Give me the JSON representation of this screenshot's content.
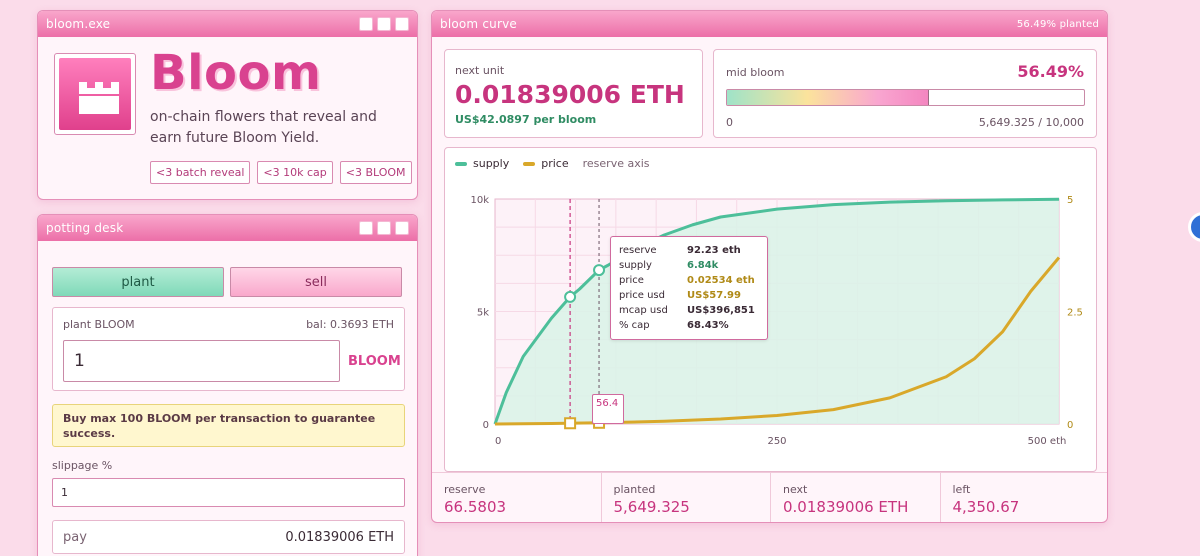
{
  "bloom_window": {
    "title": "bloom.exe",
    "brand": "Bloom",
    "tagline": "on-chain flowers that reveal and earn future Bloom Yield.",
    "chips": [
      "<3 batch reveal",
      "<3 10k cap",
      "<3 BLOOM"
    ]
  },
  "desk_window": {
    "title": "potting desk",
    "tabs": {
      "plant": "plant",
      "sell": "sell"
    },
    "field_label": "plant BLOOM",
    "balance": "bal: 0.3693 ETH",
    "amount": "1",
    "unit": "BLOOM",
    "warning": "Buy max 100 BLOOM per transaction to guarantee success.",
    "slippage_label": "slippage %",
    "slippage_value": "1",
    "pay_label": "pay",
    "pay_value": "0.01839006 ETH"
  },
  "curve_window": {
    "title": "bloom curve",
    "planted_badge": "56.49% planted",
    "next_unit": {
      "label": "next unit",
      "value": "0.01839006 ETH",
      "usd": "US$42.0897 per bloom"
    },
    "mid_bloom": {
      "label": "mid bloom",
      "pct": "56.49%",
      "fraction": 0.5649,
      "min": "0",
      "count": "5,649.325 / 10,000"
    },
    "legend": {
      "supply": "supply",
      "price": "price",
      "axis": "reserve axis"
    },
    "tooltip": {
      "rows": [
        {
          "k": "reserve",
          "v": "92.23 eth"
        },
        {
          "k": "supply",
          "v": "6.84k"
        },
        {
          "k": "price",
          "v": "0.02534 eth"
        },
        {
          "k": "price usd",
          "v": "US$57.99"
        },
        {
          "k": "mcap usd",
          "v": "US$396,851"
        },
        {
          "k": "% cap",
          "v": "68.43%"
        }
      ]
    },
    "mini_label": "56.4",
    "stats": [
      {
        "label": "reserve",
        "value": "66.5803"
      },
      {
        "label": "planted",
        "value": "5,649.325"
      },
      {
        "label": "next",
        "value": "0.01839006 ETH"
      },
      {
        "label": "left",
        "value": "4,350.67"
      }
    ]
  },
  "colors": {
    "supply": "#4dbf9a",
    "price": "#d9a82a",
    "accent": "#d9428f"
  },
  "chart_data": {
    "type": "line",
    "x_axis": {
      "ticks": [
        "0",
        "250",
        "500 eth"
      ],
      "range": [
        0,
        500
      ]
    },
    "y_left": {
      "ticks": [
        "0",
        "5k",
        "10k"
      ],
      "range": [
        0,
        10000
      ]
    },
    "y_right": {
      "ticks": [
        "0",
        "2.5",
        "5"
      ],
      "range": [
        0,
        5
      ]
    },
    "series": [
      {
        "name": "supply",
        "x": [
          0,
          10,
          25,
          50,
          66.58,
          75,
          92.23,
          100,
          125,
          150,
          175,
          200,
          250,
          300,
          350,
          400,
          450,
          500
        ],
        "y": [
          0,
          1400,
          3000,
          4700,
          5649,
          6000,
          6840,
          7050,
          7800,
          8400,
          8850,
          9200,
          9550,
          9750,
          9860,
          9920,
          9960,
          9990
        ]
      },
      {
        "name": "price",
        "x": [
          0,
          50,
          100,
          150,
          200,
          250,
          300,
          350,
          400,
          425,
          450,
          475,
          500
        ],
        "y": [
          0,
          0.01,
          0.03,
          0.06,
          0.11,
          0.19,
          0.32,
          0.58,
          1.05,
          1.45,
          2.05,
          2.95,
          3.7
        ]
      }
    ],
    "markers": [
      {
        "x": 66.58,
        "label": "current"
      },
      {
        "x": 92.23,
        "label": "hover"
      }
    ]
  }
}
